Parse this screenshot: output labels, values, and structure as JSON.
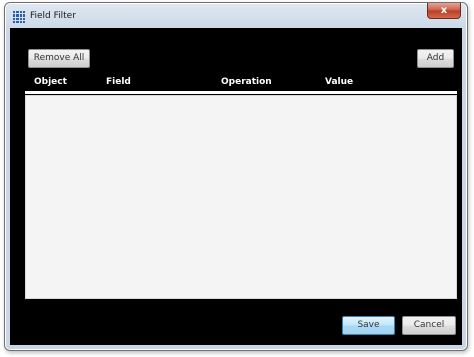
{
  "window": {
    "title": "Field Filter",
    "close_glyph": "x",
    "icon": "grid-icon"
  },
  "toolbar": {
    "remove_all_label": "Remove All",
    "add_label": "Add"
  },
  "table": {
    "columns": [
      "Object",
      "Field",
      "Operation",
      "Value"
    ],
    "rows": []
  },
  "footer": {
    "save_label": "Save",
    "cancel_label": "Cancel"
  },
  "colors": {
    "client_background": "#000000",
    "grid_background": "#f4f4f4",
    "header_text": "#ffffff",
    "save_button_accent": "#bee6fd"
  }
}
